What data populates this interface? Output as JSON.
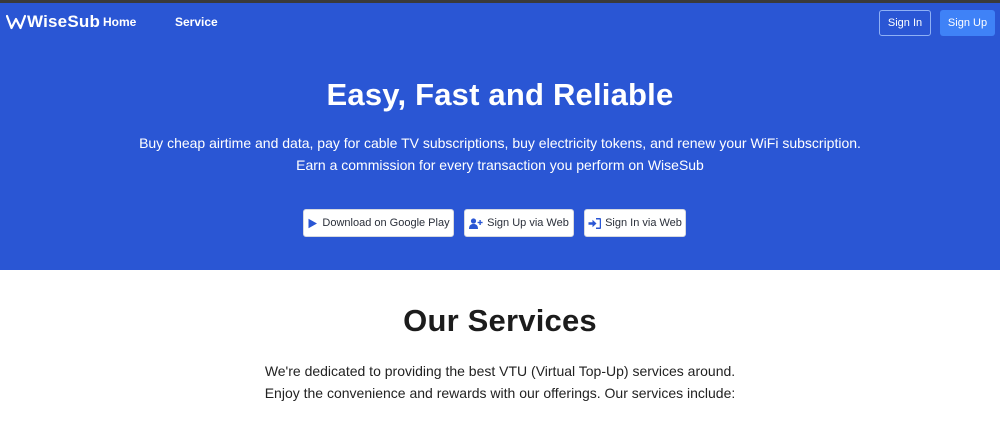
{
  "nav": {
    "logo_text": "WiseSub",
    "links": [
      "Home",
      "Service"
    ],
    "sign_in": "Sign In",
    "sign_up": "Sign Up"
  },
  "hero": {
    "title": "Easy, Fast and Reliable",
    "subtitle_line1": "Buy cheap airtime and data, pay for cable TV subscriptions, buy electricity tokens, and renew your WiFi subscription.",
    "subtitle_line2": "Earn a commission for every transaction you perform on WiseSub",
    "buttons": [
      {
        "label": "Download on Google Play",
        "icon": "google-play-icon"
      },
      {
        "label": "Sign Up via Web",
        "icon": "user-plus-icon"
      },
      {
        "label": "Sign In via Web",
        "icon": "sign-in-icon"
      }
    ]
  },
  "services": {
    "title": "Our Services",
    "desc_line1": "We're dedicated to providing the best VTU (Virtual Top-Up) services around.",
    "desc_line2": "Enjoy the convenience and rewards with our offerings. Our services include:"
  },
  "colors": {
    "hero_bg": "#2a56d4",
    "signup_button": "#3f82f7",
    "icon_blue": "#2a56d4",
    "text_dark": "#1c1c1c"
  }
}
